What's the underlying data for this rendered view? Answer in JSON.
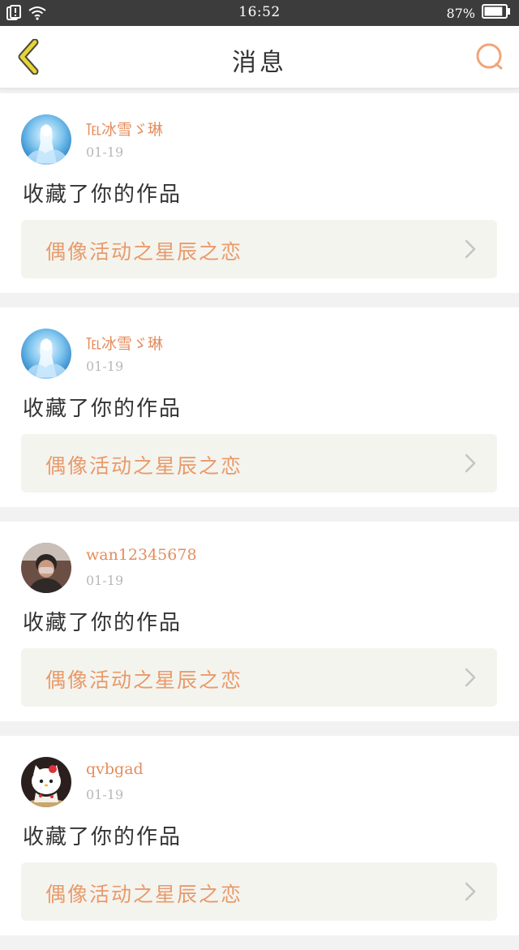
{
  "status_bar": {
    "time": "16:52",
    "battery": "87%",
    "battery_level": 0.87,
    "icons": [
      "notification-icon",
      "wifi-icon",
      "battery-icon"
    ]
  },
  "header": {
    "title": "消息",
    "back_icon": "chevron-left-icon",
    "search_icon": "search-icon",
    "accent_color": "#f0a57a",
    "back_color": "#e8d33a"
  },
  "colors": {
    "username": "#e48d5e",
    "work_title": "#e89a6a",
    "date": "#b8b8b8",
    "card_link_bg": "#f4f4ef"
  },
  "messages": [
    {
      "username": "℡冰雪ゞ琳",
      "date": "01-19",
      "text": "收藏了你的作品",
      "work_title": "偶像活动之星辰之恋",
      "avatar": "blue-anime-avatar"
    },
    {
      "username": "℡冰雪ゞ琳",
      "date": "01-19",
      "text": "收藏了你的作品",
      "work_title": "偶像活动之星辰之恋",
      "avatar": "blue-anime-avatar"
    },
    {
      "username": "wan12345678",
      "date": "01-19",
      "text": "收藏了你的作品",
      "work_title": "偶像活动之星辰之恋",
      "avatar": "photo-avatar"
    },
    {
      "username": "qvbgad",
      "date": "01-19",
      "text": "收藏了你的作品",
      "work_title": "偶像活动之星辰之恋",
      "avatar": "cat-avatar"
    }
  ]
}
